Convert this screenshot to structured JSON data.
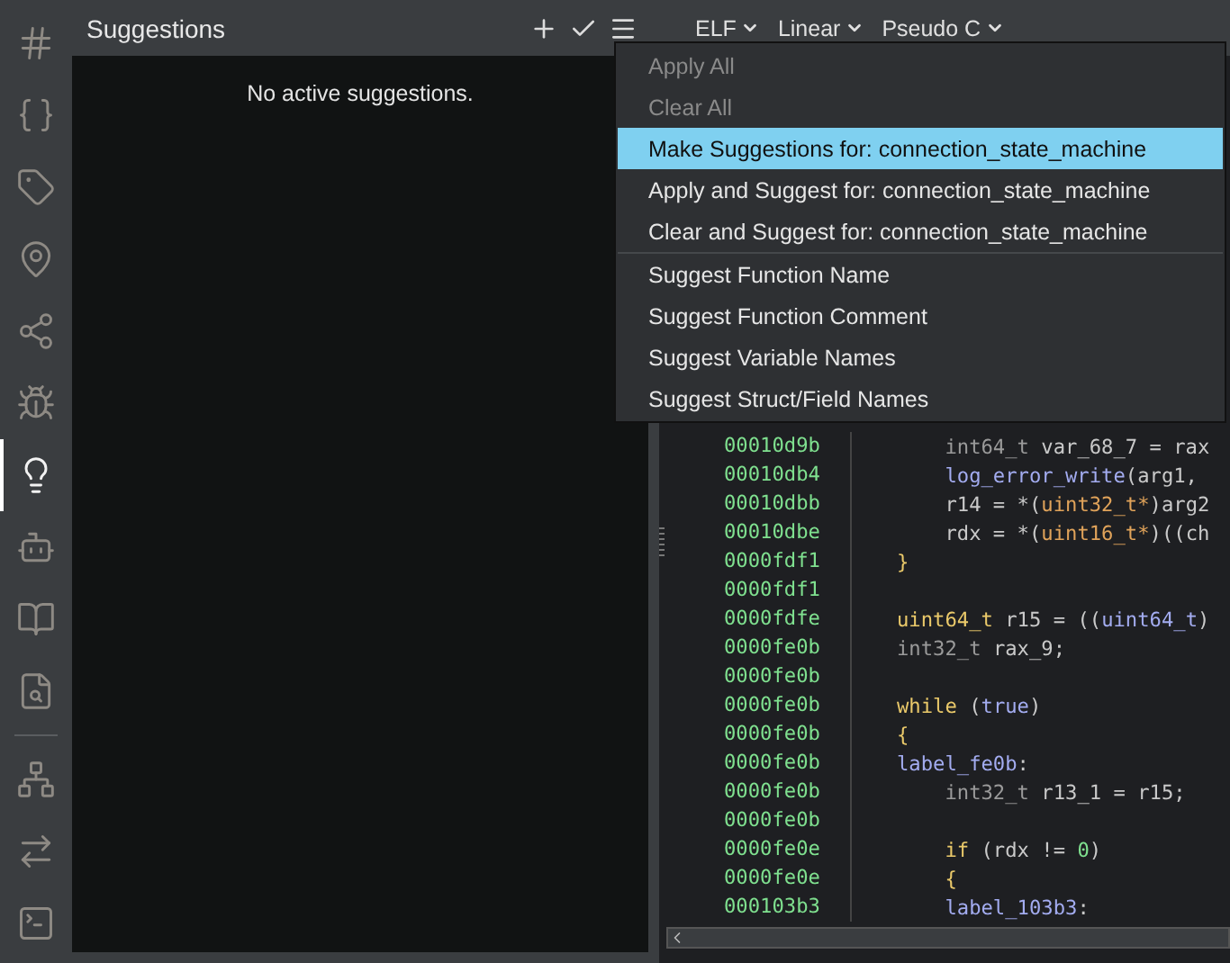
{
  "sidebar": {
    "groups": [
      {
        "items": [
          {
            "selected": false
          },
          {
            "selected": false
          },
          {
            "selected": false
          },
          {
            "selected": false
          },
          {
            "selected": false
          },
          {
            "selected": false
          },
          {
            "selected": true
          },
          {
            "selected": false
          },
          {
            "selected": false
          },
          {
            "selected": false
          }
        ]
      },
      {
        "items": [
          {
            "selected": false
          },
          {
            "selected": false
          },
          {
            "selected": false
          }
        ]
      }
    ]
  },
  "panel": {
    "title": "Suggestions",
    "empty_message": "No active suggestions."
  },
  "toolbar": {
    "dropdowns": [
      "ELF",
      "Linear",
      "Pseudo C"
    ]
  },
  "menu": {
    "sections": [
      {
        "items": [
          {
            "label": "Apply All",
            "disabled": true,
            "selected": false
          },
          {
            "label": "Clear All",
            "disabled": true,
            "selected": false
          },
          {
            "label": "Make Suggestions for: connection_state_machine",
            "disabled": false,
            "selected": true
          },
          {
            "label": "Apply and Suggest for: connection_state_machine",
            "disabled": false,
            "selected": false
          },
          {
            "label": "Clear and Suggest for: connection_state_machine",
            "disabled": false,
            "selected": false
          }
        ]
      },
      {
        "items": [
          {
            "label": "Suggest Function Name",
            "disabled": false,
            "selected": false
          },
          {
            "label": "Suggest Function Comment",
            "disabled": false,
            "selected": false
          },
          {
            "label": "Suggest Variable Names",
            "disabled": false,
            "selected": false
          },
          {
            "label": "Suggest Struct/Field Names",
            "disabled": false,
            "selected": false
          }
        ]
      }
    ]
  },
  "code": {
    "lines": [
      {
        "address": "00010d9b",
        "tokens": [
          {
            "text": "    int64_t",
            "kind": "dimtype"
          },
          {
            "text": " var_68_7 = rax",
            "kind": "plain"
          }
        ]
      },
      {
        "address": "00010db4",
        "tokens": [
          {
            "text": "    log_error_write",
            "kind": "func"
          },
          {
            "text": "(arg1,",
            "kind": "plain"
          }
        ]
      },
      {
        "address": "00010dbb",
        "tokens": [
          {
            "text": "    r14 = *(",
            "kind": "plain"
          },
          {
            "text": "uint32_t*",
            "kind": "type"
          },
          {
            "text": ")arg2",
            "kind": "plain"
          }
        ]
      },
      {
        "address": "00010dbe",
        "tokens": [
          {
            "text": "    rdx = *(",
            "kind": "plain"
          },
          {
            "text": "uint16_t*",
            "kind": "type"
          },
          {
            "text": ")((ch",
            "kind": "plain"
          }
        ]
      },
      {
        "address": "0000fdf1",
        "tokens": [
          {
            "text": "}",
            "kind": "keyword"
          }
        ]
      },
      {
        "address": "0000fdf1"
      },
      {
        "address": "0000fdfe",
        "tokens": [
          {
            "text": "uint64_t",
            "kind": "keyword"
          },
          {
            "text": " r15 = ((",
            "kind": "plain"
          },
          {
            "text": "uint64_t",
            "kind": "func"
          },
          {
            "text": ")",
            "kind": "plain"
          }
        ]
      },
      {
        "address": "0000fe0b",
        "tokens": [
          {
            "text": "int32_t",
            "kind": "dimtype"
          },
          {
            "text": " rax_9;",
            "kind": "plain"
          }
        ]
      },
      {
        "address": "0000fe0b"
      },
      {
        "address": "0000fe0b",
        "tokens": [
          {
            "text": "while",
            "kind": "keyword"
          },
          {
            "text": " (",
            "kind": "plain"
          },
          {
            "text": "true",
            "kind": "func"
          },
          {
            "text": ")",
            "kind": "plain"
          }
        ]
      },
      {
        "address": "0000fe0b",
        "tokens": [
          {
            "text": "{",
            "kind": "keyword"
          }
        ]
      },
      {
        "address": "0000fe0b",
        "tokens": [
          {
            "text": "label_fe0b",
            "kind": "func"
          },
          {
            "text": ":",
            "kind": "plain"
          }
        ]
      },
      {
        "address": "0000fe0b",
        "tokens": [
          {
            "text": "    int32_t",
            "kind": "dimtype"
          },
          {
            "text": " r13_1 = r15;",
            "kind": "plain"
          }
        ]
      },
      {
        "address": "0000fe0b"
      },
      {
        "address": "0000fe0e",
        "tokens": [
          {
            "text": "    if",
            "kind": "keyword"
          },
          {
            "text": " (rdx != ",
            "kind": "plain"
          },
          {
            "text": "0",
            "kind": "number"
          },
          {
            "text": ")",
            "kind": "plain"
          }
        ]
      },
      {
        "address": "0000fe0e",
        "tokens": [
          {
            "text": "    {",
            "kind": "keyword"
          }
        ]
      },
      {
        "address": "000103b3",
        "tokens": [
          {
            "text": "    label_103b3",
            "kind": "func"
          },
          {
            "text": ":",
            "kind": "plain"
          }
        ]
      }
    ]
  }
}
